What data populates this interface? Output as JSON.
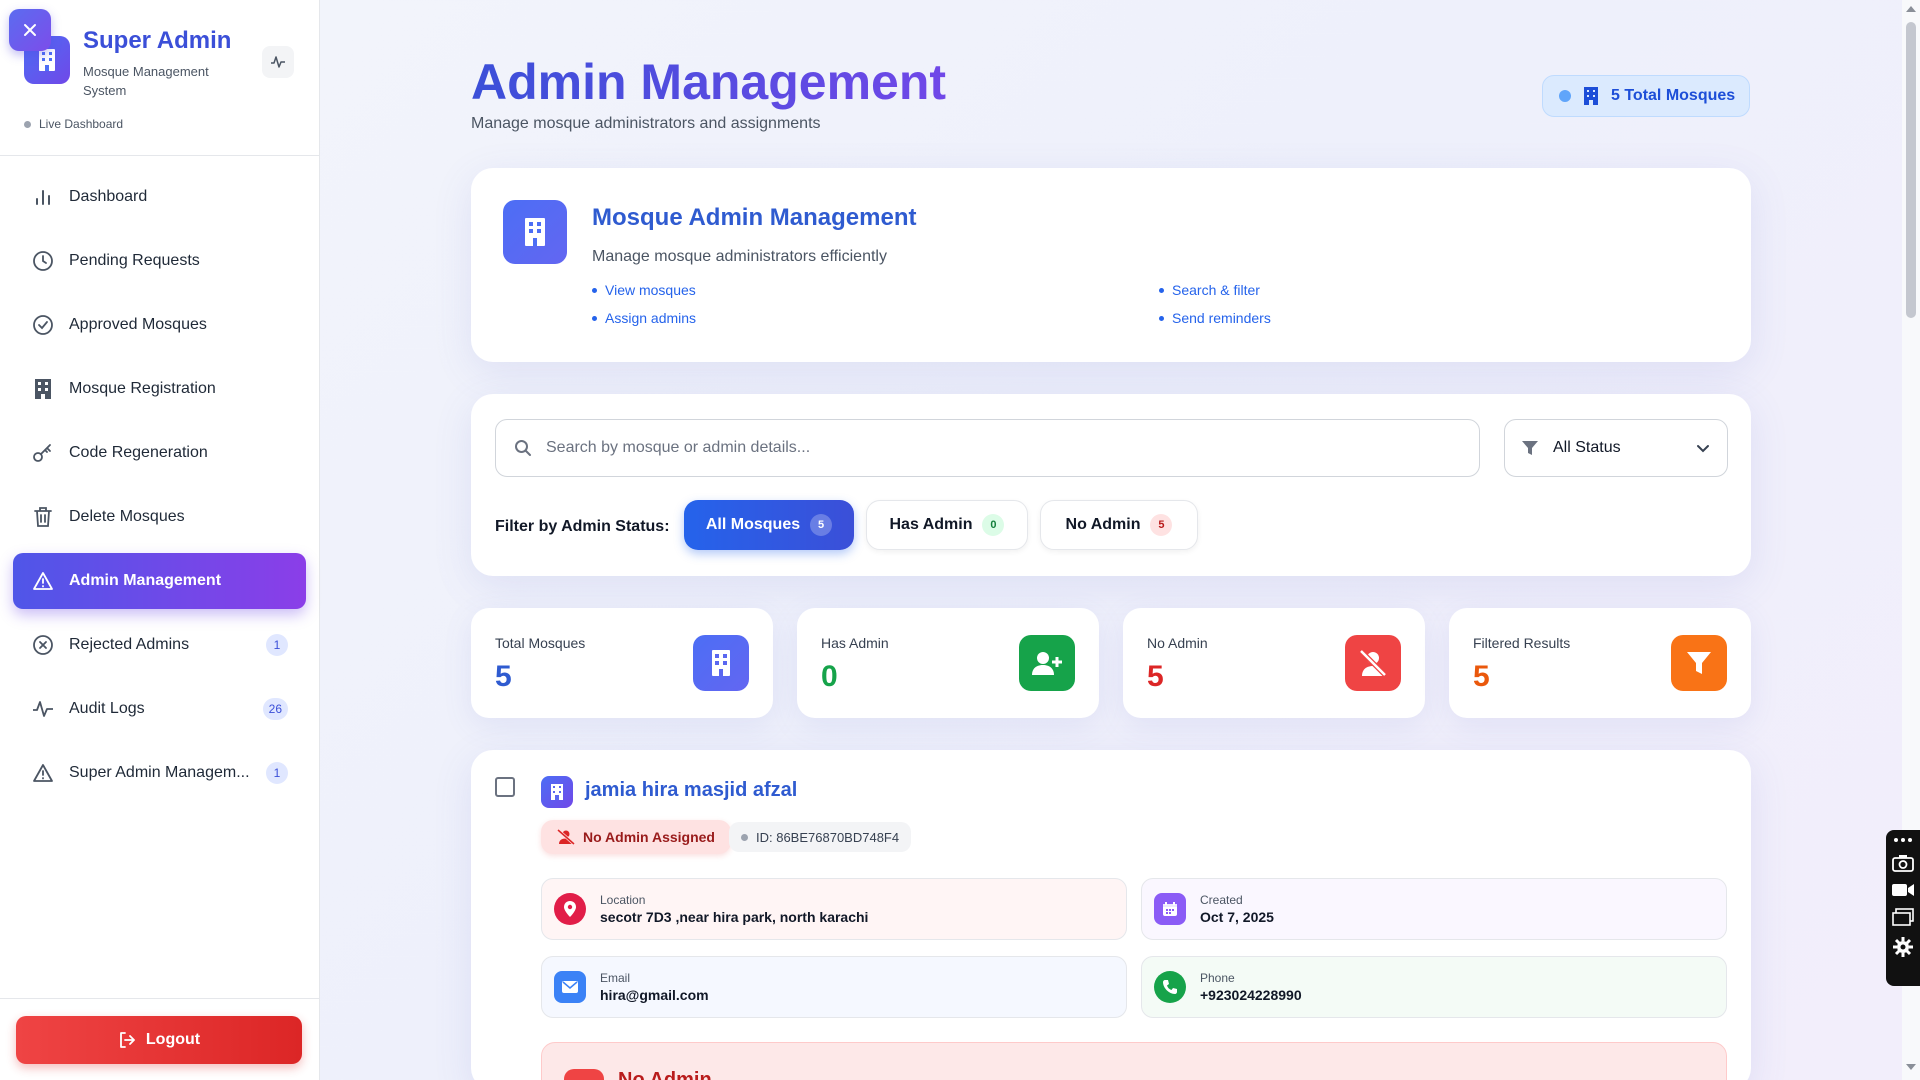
{
  "sidebar": {
    "brand_title": "Super Admin",
    "brand_subtitle": "Mosque Management System",
    "live_label": "Live Dashboard",
    "items": [
      {
        "label": "Dashboard",
        "icon": "bar-chart-icon"
      },
      {
        "label": "Pending Requests",
        "icon": "clock-icon"
      },
      {
        "label": "Approved Mosques",
        "icon": "check-circle-icon"
      },
      {
        "label": "Mosque Registration",
        "icon": "building-icon"
      },
      {
        "label": "Code Regeneration",
        "icon": "key-icon"
      },
      {
        "label": "Delete Mosques",
        "icon": "trash-icon"
      },
      {
        "label": "Admin Management",
        "icon": "warning-icon",
        "active": true
      },
      {
        "label": "Rejected Admins",
        "icon": "x-circle-icon",
        "badge": "1"
      },
      {
        "label": "Audit Logs",
        "icon": "activity-icon",
        "badge": "26"
      },
      {
        "label": "Super Admin Managem...",
        "icon": "warning-icon",
        "badge": "1"
      }
    ],
    "logout_label": "Logout"
  },
  "header": {
    "title": "Admin Management",
    "subtitle": "Manage mosque administrators and assignments",
    "total_pill": "5 Total Mosques"
  },
  "info_card": {
    "title": "Mosque Admin Management",
    "subtitle": "Manage mosque administrators efficiently",
    "features": [
      "View mosques",
      "Assign admins",
      "Search & filter",
      "Send reminders"
    ]
  },
  "filters": {
    "search_placeholder": "Search by mosque or admin details...",
    "status_selected": "All Status",
    "filter_label": "Filter by Admin Status:",
    "chips": [
      {
        "label": "All Mosques",
        "count": "5"
      },
      {
        "label": "Has Admin",
        "count": "0"
      },
      {
        "label": "No Admin",
        "count": "5"
      }
    ]
  },
  "stats": [
    {
      "label": "Total Mosques",
      "value": "5",
      "color": "#2f5bd0"
    },
    {
      "label": "Has Admin",
      "value": "0",
      "color": "#16a34a"
    },
    {
      "label": "No Admin",
      "value": "5",
      "color": "#dc2626"
    },
    {
      "label": "Filtered Results",
      "value": "5",
      "color": "#ea580c"
    }
  ],
  "mosque": {
    "name": "jamia hira masjid afzal",
    "status_badge": "No Admin Assigned",
    "id": "ID: 86BE76870BD748F4",
    "location_label": "Location",
    "location": "secotr 7D3 ,near hira park, north karachi",
    "created_label": "Created",
    "created": "Oct 7, 2025",
    "email_label": "Email",
    "email": "hira@gmail.com",
    "phone_label": "Phone",
    "phone": "+923024228990",
    "bottom_banner": "No Admin"
  },
  "colors": {
    "accent": "#3b4fd8",
    "active_gradient_start": "#4f56e8",
    "active_gradient_end": "#8b3ee8",
    "danger": "#ef4444"
  }
}
